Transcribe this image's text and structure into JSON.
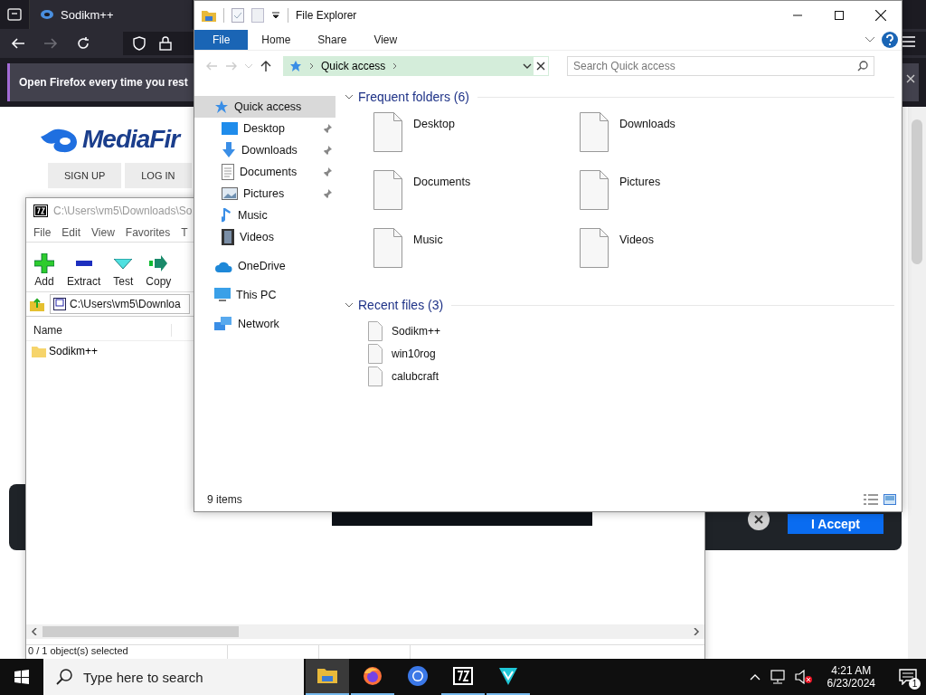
{
  "browser": {
    "tab": {
      "title": "Sodikm++",
      "selected": true
    },
    "navigation": {
      "back_enabled": true,
      "forward_enabled": false
    },
    "notification": {
      "text": "Open Firefox every time you rest"
    },
    "page": {
      "logo": "MediaFir",
      "nav_links": [
        "SIGN UP",
        "LOG IN"
      ],
      "cookie_banner": {
        "accept_button": "I Accept"
      }
    }
  },
  "archive_window": {
    "title": "C:\\Users\\vm5\\Downloads\\So",
    "menu": [
      "File",
      "Edit",
      "View",
      "Favorites",
      "T"
    ],
    "toolbar": [
      "Add",
      "Extract",
      "Test",
      "Copy"
    ],
    "path": "C:\\Users\\vm5\\Downloa",
    "columns": [
      "Name"
    ],
    "rows": [
      {
        "name": "Sodikm++",
        "selected": false
      }
    ],
    "status": "0 / 1 object(s) selected"
  },
  "file_explorer": {
    "title": "File Explorer",
    "ribbon_tabs": [
      {
        "label": "File",
        "selected": true
      },
      {
        "label": "Home",
        "selected": false
      },
      {
        "label": "Share",
        "selected": false
      },
      {
        "label": "View",
        "selected": false
      }
    ],
    "navigation": {
      "back_enabled": false,
      "forward_enabled": false,
      "up_enabled": true
    },
    "address": {
      "crumbs": [
        "Quick access"
      ]
    },
    "search": {
      "placeholder": "Search Quick access"
    },
    "nav_pane": [
      {
        "label": "Quick access",
        "selected": true,
        "children": [
          {
            "label": "Desktop",
            "pinned": true
          },
          {
            "label": "Downloads",
            "pinned": true
          },
          {
            "label": "Documents",
            "pinned": true
          },
          {
            "label": "Pictures",
            "pinned": true
          },
          {
            "label": "Music",
            "pinned": false
          },
          {
            "label": "Videos",
            "pinned": false
          }
        ]
      },
      {
        "label": "OneDrive",
        "selected": false
      },
      {
        "label": "This PC",
        "selected": false
      },
      {
        "label": "Network",
        "selected": false
      }
    ],
    "sections": [
      {
        "title": "Frequent folders (6)",
        "expanded": true,
        "kind": "tiles",
        "items": [
          "Desktop",
          "Downloads",
          "Documents",
          "Pictures",
          "Music",
          "Videos"
        ]
      },
      {
        "title": "Recent files (3)",
        "expanded": true,
        "kind": "list",
        "items": [
          "Sodikm++",
          "win10rog",
          "calubcraft"
        ]
      }
    ],
    "status": "9 items"
  },
  "taskbar": {
    "search": {
      "placeholder": "Type here to search"
    },
    "apps": [
      {
        "running": true,
        "selected": true
      },
      {
        "running": true,
        "selected": false
      },
      {
        "running": false,
        "selected": false
      },
      {
        "running": true,
        "selected": false
      },
      {
        "running": true,
        "selected": false
      }
    ],
    "volume_muted": true,
    "clock": {
      "time": "4:21 AM",
      "date": "6/23/2024"
    },
    "notifications": {
      "count": "1"
    }
  }
}
